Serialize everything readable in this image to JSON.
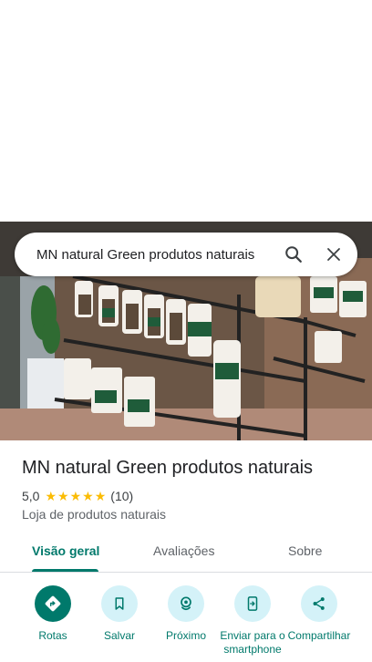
{
  "search": {
    "query": "MN natural Green produtos naturais"
  },
  "place": {
    "title": "MN natural Green produtos naturais",
    "rating": "5,0",
    "stars": [
      "★",
      "★",
      "★",
      "★",
      "★"
    ],
    "reviews": "(10)",
    "category": "Loja de produtos naturais"
  },
  "tabs": [
    {
      "label": "Visão geral"
    },
    {
      "label": "Avaliações"
    },
    {
      "label": "Sobre"
    }
  ],
  "actions": [
    {
      "label": "Rotas",
      "icon": "directions-icon"
    },
    {
      "label": "Salvar",
      "icon": "bookmark-icon"
    },
    {
      "label": "Próximo",
      "icon": "nearby-icon"
    },
    {
      "label": "Enviar para o smartphone",
      "icon": "send-to-phone-icon"
    },
    {
      "label": "Compartilhar",
      "icon": "share-icon"
    }
  ],
  "colors": {
    "accent": "#00796b",
    "action_bg": "#d4f2f8",
    "star": "#fbbc04"
  }
}
